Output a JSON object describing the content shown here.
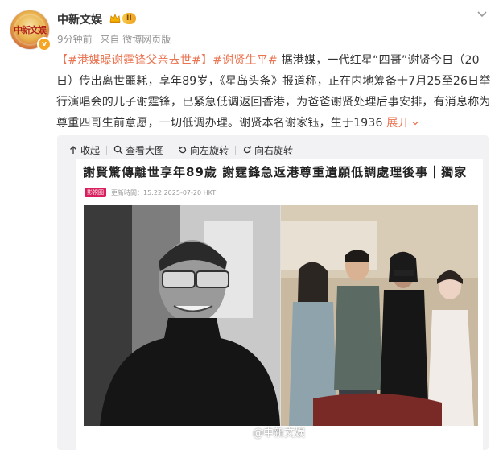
{
  "user": {
    "name": "中新文娱",
    "avatar_text": "中新文娱",
    "vip_level": "II"
  },
  "meta": {
    "time": "9分钟前",
    "source": "来自 微博网页版"
  },
  "post": {
    "tag1": "【#港媒曝谢霆锋父亲去世#】",
    "tag2": "#谢贤生平#",
    "body": " 据港媒，一代红星“四哥”谢贤今日（20日）传出离世噩耗，享年89岁，《星岛头条》报道称，正在内地筹备于7月25至26日举行演唱会的儿子谢霆锋，已紧急低调返回香港，为爸爸谢贤处理后事安排，有消息称为尊重四哥生前意愿，一切低调办理。谢贤本名谢家钰，生于1936 ",
    "expand_label": "展开",
    "expand_icon": "chevron-down-icon"
  },
  "toolbar": {
    "collapse_label": "收起",
    "view_large_label": "查看大图",
    "rotate_left_label": "向左旋转",
    "rotate_right_label": "向右旋转"
  },
  "article": {
    "headline": "謝賢驚傳離世享年89歲 謝霆鋒急返港尊重遺願低調處理後事｜獨家",
    "source_logo": "影視圈",
    "source_meta": "更新時間：15:22 2025-07-20 HKT"
  },
  "watermark": "@中新文娱",
  "colors": {
    "tag": "#eb7350",
    "meta": "#939393",
    "card_bg": "#f2f2f5"
  }
}
